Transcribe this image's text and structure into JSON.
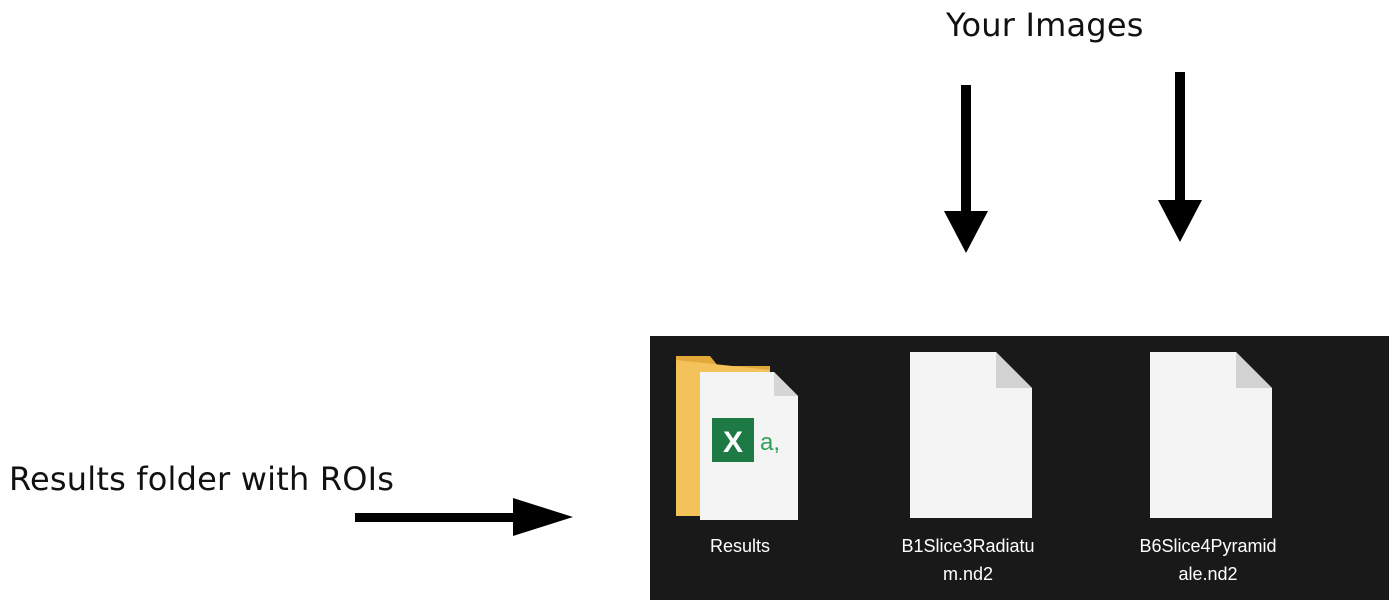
{
  "annotations": {
    "images_caption": "Your Images",
    "results_caption": "Results folder with ROIs"
  },
  "explorer": {
    "background": "#191919",
    "items": [
      {
        "label": "Results",
        "type": "folder",
        "icon": "folder-with-excel-file-icon",
        "badge_letter": "X",
        "badge_text": "a,"
      },
      {
        "label": "B1Slice3Radiatum.nd2",
        "label_lines": [
          "B1Slice3Radiatu",
          "m.nd2"
        ],
        "type": "file",
        "icon": "blank-file-icon"
      },
      {
        "label": "B6Slice4Pyramidale.nd2",
        "label_lines": [
          "B6Slice4Pyramid",
          "ale.nd2"
        ],
        "type": "file",
        "icon": "blank-file-icon"
      }
    ]
  },
  "colors": {
    "folder": "#F3C25A",
    "folder_shade": "#E2A93A",
    "excel_green": "#1E7A45",
    "file_white": "#F4F4F4"
  }
}
